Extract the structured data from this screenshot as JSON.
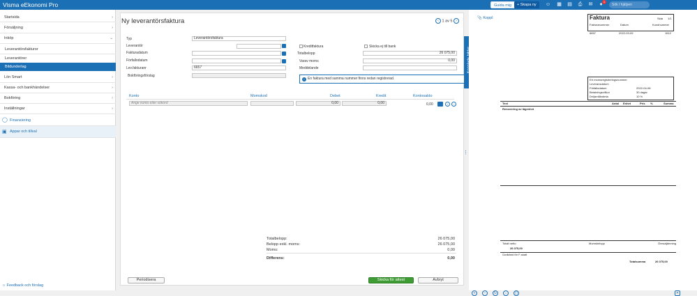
{
  "topbar": {
    "app_name": "Visma eEkonomi Pro",
    "guide_label": "Guida mig",
    "create_label": "+ Skapa ny",
    "search_placeholder": "Sök / hjälpen",
    "notifications_count": "1"
  },
  "sidebar": {
    "items": [
      "Startsida",
      "Försäljning",
      "Inköp"
    ],
    "sub_items": [
      "Leverantörsfakturor",
      "Leverantörer",
      "Bildunderlag"
    ],
    "more_items": [
      "Lön Smart",
      "Kassa- och bankhändelser",
      "Bokföring",
      "Inställningar"
    ],
    "financing": "Finansiering",
    "apps": "Appar och tillval",
    "feedback": "Feedback och förslag"
  },
  "form": {
    "title": "Ny leverantörsfaktura",
    "pager": "1 av 5",
    "typ_label": "Typ",
    "typ_value": "Leverantörsfaktura",
    "leverantor_label": "Leverantör",
    "fakturadatum_label": "Fakturadatum",
    "forfallodatum_label": "Förfallodatum",
    "levfakturanr_label": "Lev.fakturanr",
    "levfakturanr_value": "6657",
    "bokforingsforslag_label": "Bokföringsförslag",
    "kreditfaktura_label": "Kreditfaktura",
    "skicka_label": "Skicka ej till bank",
    "totalbelopp_label": "Totalbelopp",
    "totalbelopp_value": "26 075,00",
    "moms_label": "Varav moms",
    "moms_value": "0,00",
    "meddelande_label": "Meddelande",
    "info_text": "En faktura med samma nummer finns redan registrerad."
  },
  "table": {
    "headers": [
      "Konto",
      "Momskod",
      "Debet",
      "Kredit",
      "Kontosaldo"
    ],
    "konto_placeholder": "Ange konto eller sökord",
    "debet": "0,00",
    "kredit": "0,00",
    "saldo": "0,00"
  },
  "totals": [
    {
      "label": "Totalbelopp:",
      "value": "26 075,00"
    },
    {
      "label": "Belopp exkl. moms:",
      "value": "26 075,00"
    },
    {
      "label": "Moms:",
      "value": "0,00"
    },
    {
      "label": "Differens:",
      "value": "0,00"
    }
  ],
  "buttons": {
    "periodisera": "Periodisera",
    "skicka": "Skicka för attest",
    "avbryt": "Avbryt"
  },
  "side_tab": "Kopplade bilder",
  "preview": {
    "link": "Koppl",
    "doc": {
      "title": "Faktura",
      "sida_label": "Sida",
      "sida_value": "1/1",
      "head": [
        "Fakturanummer",
        "Datum",
        "Kundnummer"
      ],
      "vals": [
        "6657",
        "2022-03-09",
        "1612"
      ],
      "info": [
        "Ert momsregistreringsnummer",
        "Leveransdatum",
        "Förfallodatum",
        "Betalningsvillkor",
        "Dröjsmålsränta"
      ],
      "info_vals": [
        "",
        "",
        "2022-04-08",
        "30 dagar",
        "10 %"
      ],
      "cols": [
        "Text",
        "Antal",
        "Enhet",
        "Pris",
        "%",
        "Summa"
      ],
      "row": "Renovering av lägenhet",
      "summary": [
        "Totalt netto",
        "Momsbelopp",
        "Öresutjämning"
      ],
      "netto_value": "26 075,00",
      "godkand": "Godkänd för F-skatt",
      "total_label": "Totalsumma",
      "total_value": "26 075,00"
    }
  }
}
